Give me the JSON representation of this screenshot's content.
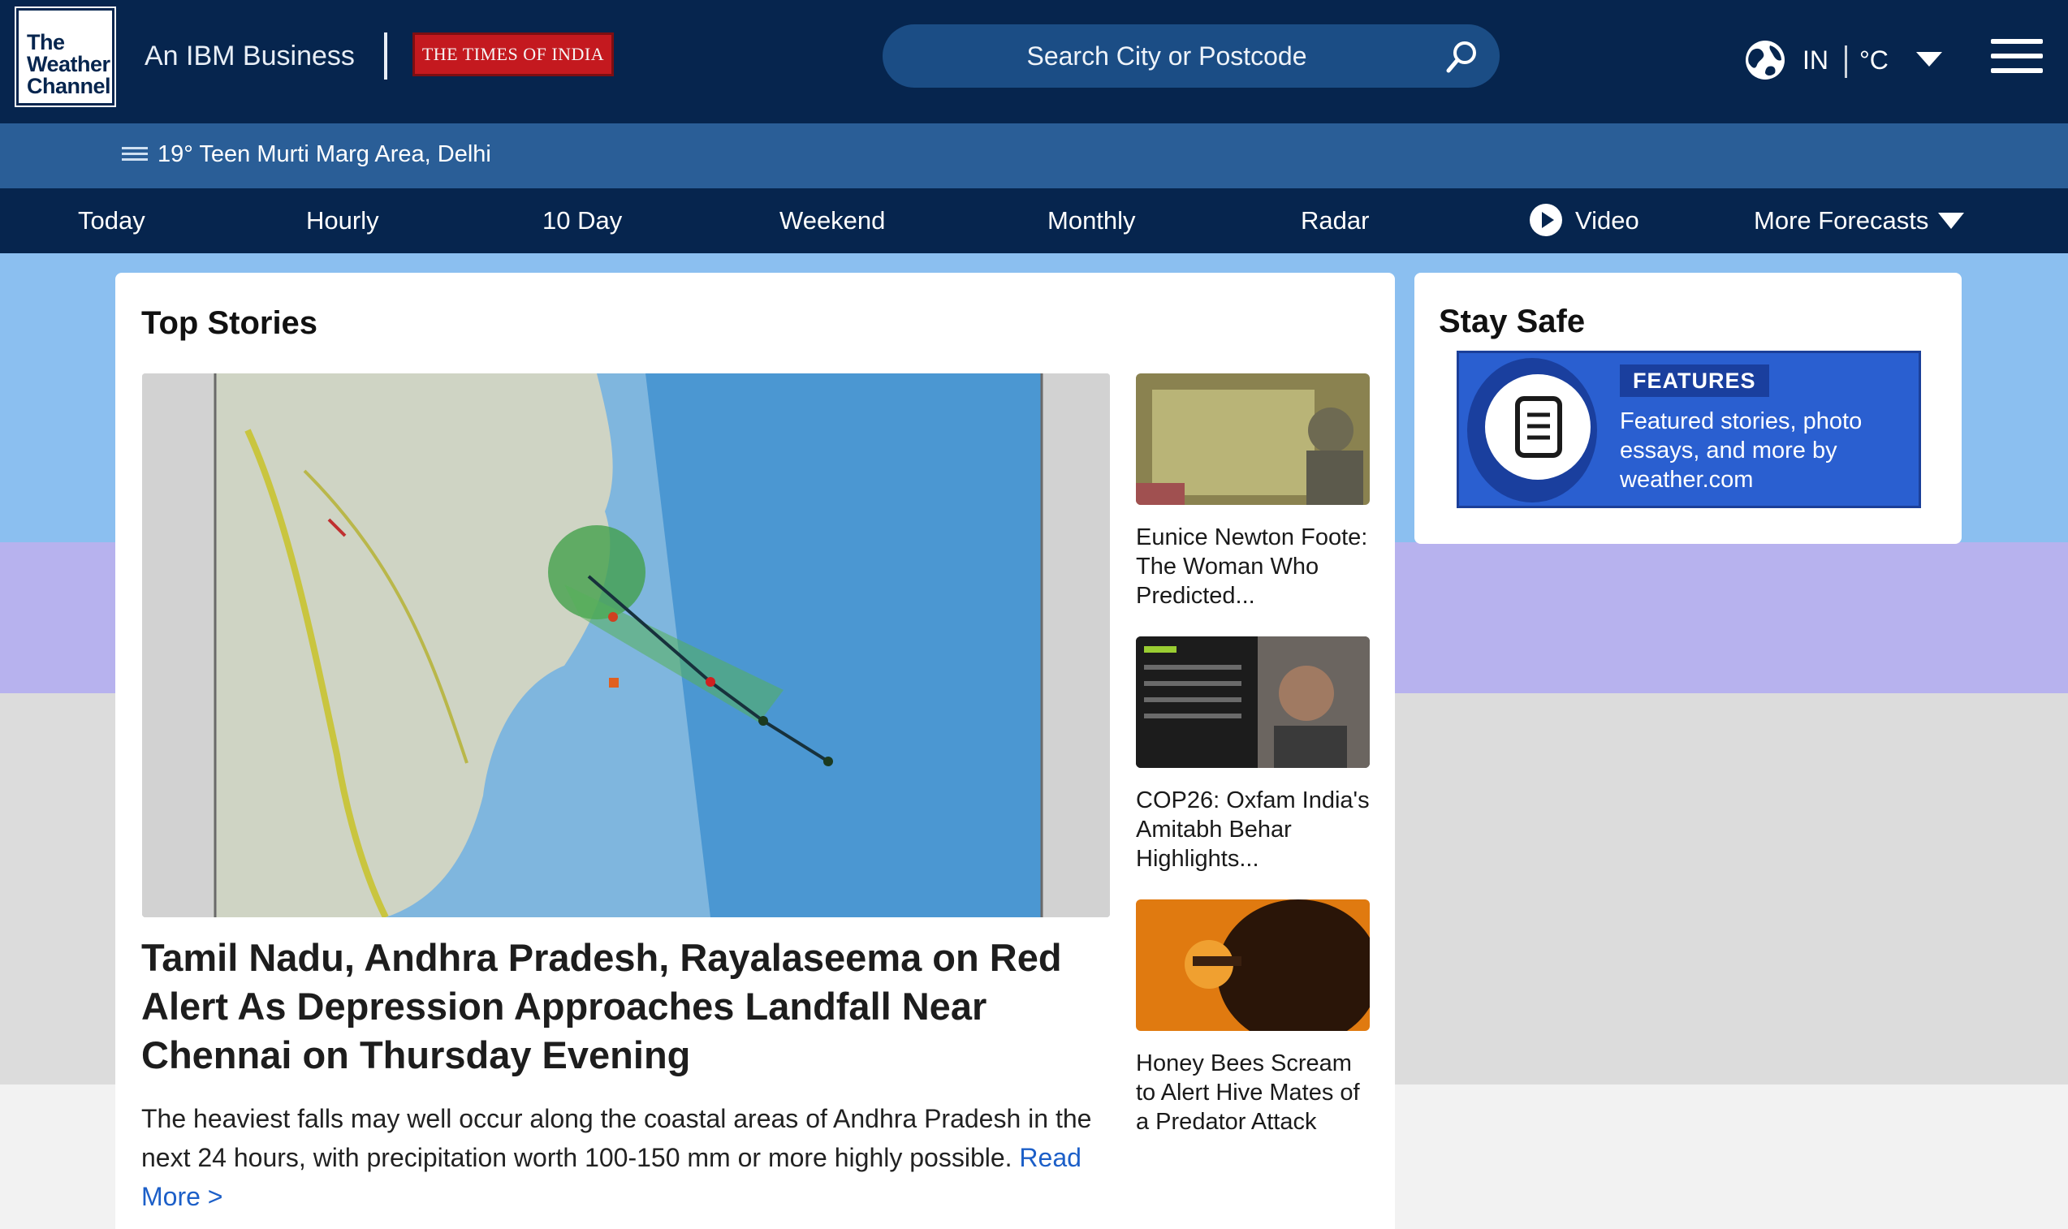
{
  "header": {
    "logo_lines": [
      "The",
      "Weather",
      "Channel"
    ],
    "ibm_text": "An IBM Business",
    "partner_logo_text": "THE TIMES OF INDIA",
    "search_placeholder": "Search City or Postcode",
    "region": "IN",
    "unit": "°C"
  },
  "location": {
    "temperature": "19°",
    "name": "Teen Murti Marg Area, Delhi"
  },
  "nav": {
    "items": [
      {
        "label": "Today"
      },
      {
        "label": "Hourly"
      },
      {
        "label": "10 Day"
      },
      {
        "label": "Weekend"
      },
      {
        "label": "Monthly"
      },
      {
        "label": "Radar"
      },
      {
        "label": "Video"
      },
      {
        "label": "More Forecasts"
      }
    ]
  },
  "top_stories": {
    "title": "Top Stories",
    "hero": {
      "title": "Tamil Nadu, Andhra Pradesh, Rayalaseema on Red Alert As Depression Approaches Landfall Near Chennai on Thursday Evening",
      "summary": "The heaviest falls may well occur along the coastal areas of Andhra Pradesh in the next 24 hours, with precipitation worth 100-150 mm or more highly possible.",
      "read_more": "Read More >"
    },
    "side_stories": [
      {
        "title": "Eunice Newton Foote: The Woman Who Predicted..."
      },
      {
        "title": "COP26: Oxfam India's Amitabh Behar Highlights..."
      },
      {
        "title": "Honey Bees Scream to Alert Hive Mates of a Predator Attack"
      }
    ]
  },
  "stay_safe": {
    "title": "Stay Safe",
    "tag": "FEATURES",
    "text": "Featured stories, photo essays, and more by weather.com"
  },
  "colors": {
    "header_bg": "#06254e",
    "location_bar_bg": "#2a5e97",
    "link": "#1c5fc8",
    "feature_bg": "#2a5fd0"
  }
}
